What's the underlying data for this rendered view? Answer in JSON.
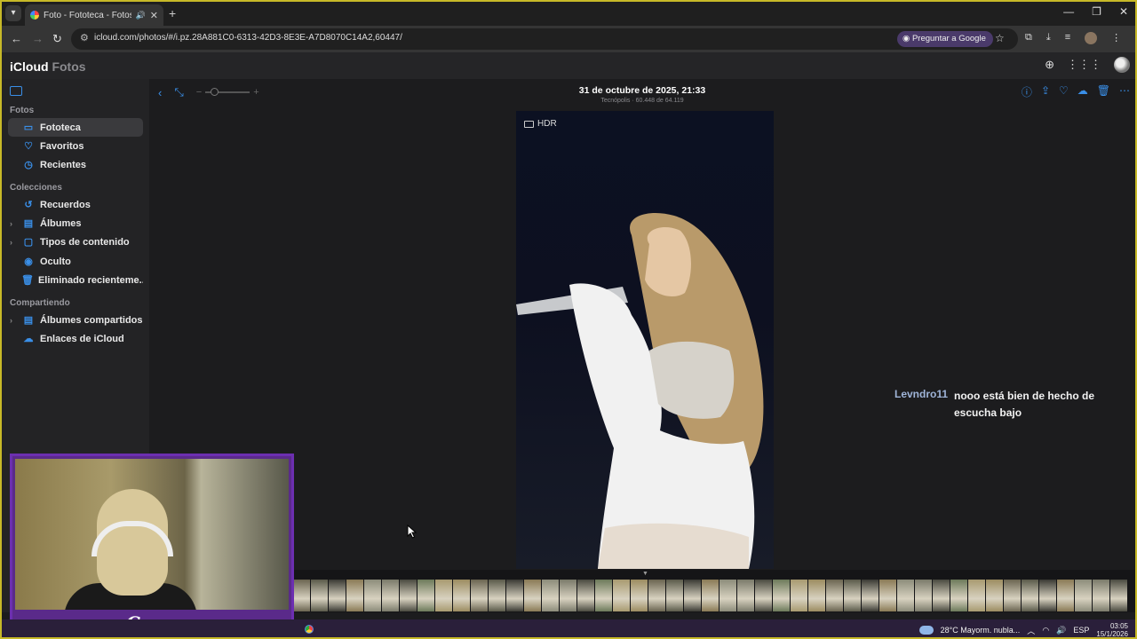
{
  "browser": {
    "tab_title": "Foto - Fototeca - Fotos en i",
    "new_tab": "+",
    "url": "icloud.com/photos/#/i.pz.28A881C0-6313-42D3-8E3E-A7D8070C14A2,60447/",
    "ask_google": "Preguntar a Google",
    "window_controls": [
      "—",
      "❐",
      "✕"
    ]
  },
  "app": {
    "brand_main": "iCloud",
    "brand_sub": "Fotos"
  },
  "sidebar": {
    "section_fotos": "Fotos",
    "fotos_items": [
      {
        "label": "Fototeca",
        "icon": "photo-library-icon",
        "active": true
      },
      {
        "label": "Favoritos",
        "icon": "heart-icon"
      },
      {
        "label": "Recientes",
        "icon": "clock-icon"
      }
    ],
    "section_colecciones": "Colecciones",
    "colecciones_items": [
      {
        "label": "Recuerdos",
        "icon": "memories-icon"
      },
      {
        "label": "Álbumes",
        "icon": "albums-icon",
        "expandable": true
      },
      {
        "label": "Tipos de contenido",
        "icon": "media-types-icon",
        "expandable": true
      },
      {
        "label": "Oculto",
        "icon": "eye-icon"
      },
      {
        "label": "Eliminado recienteme...",
        "icon": "trash-icon"
      }
    ],
    "section_compartiendo": "Compartiendo",
    "compartiendo_items": [
      {
        "label": "Álbumes compartidos",
        "icon": "shared-albums-icon",
        "expandable": true
      },
      {
        "label": "Enlaces de iCloud",
        "icon": "icloud-links-icon"
      }
    ]
  },
  "viewer": {
    "date": "31 de octubre de 2025, 21:33",
    "location": "Tecnópolis · 60.448 de 64.119",
    "hdr_label": "HDR"
  },
  "chat_overlay": {
    "username": "Levndro11",
    "message": "nooo está bien de hecho de escucha bajo"
  },
  "webcam": {
    "logo_text": "Carp"
  },
  "taskbar": {
    "weather": "28°C  Mayorm. nubla...",
    "lang": "ESP",
    "time": "03:05",
    "date": "15/1/2026"
  },
  "colors": {
    "accent": "#3a8fe8",
    "frame": "#c7b928",
    "webcam_border": "#6c2fb0"
  }
}
